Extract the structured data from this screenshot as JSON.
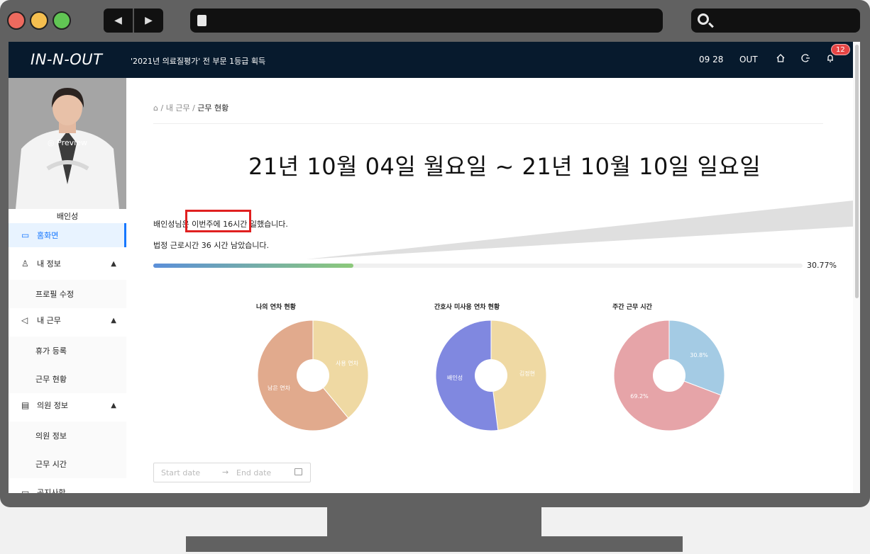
{
  "app": {
    "logo": "IN-N-OUT",
    "notice": "'2021년 의료질평가' 전 부문 1등급 획득"
  },
  "header": {
    "time": "09 28",
    "out_label": "OUT",
    "notification_count": "12"
  },
  "sidebar": {
    "preview_label": "Preview",
    "username": "배인성",
    "items": [
      {
        "label": "홈화면",
        "icon": "monitor-icon"
      },
      {
        "label": "내 정보",
        "icon": "user-icon"
      },
      {
        "label": "프로필 수정"
      },
      {
        "label": "내 근무",
        "icon": "megaphone-icon"
      },
      {
        "label": "휴가 등록"
      },
      {
        "label": "근무 현황"
      },
      {
        "label": "의원 정보",
        "icon": "document-icon"
      },
      {
        "label": "의원 정보"
      },
      {
        "label": "근무 시간"
      },
      {
        "label": "공지사항",
        "icon": "board-icon"
      }
    ]
  },
  "breadcrumb": {
    "home_icon": "home-icon",
    "sep": "/",
    "level1": "내 근무",
    "current": "근무 현황"
  },
  "week": {
    "title": "21년 10월 04일 월요일 ~ 21년 10월 10일 일요일"
  },
  "summary": {
    "line1_prefix": "배인성님은 ",
    "line1_highlight": "이번주에 16시간",
    "line1_suffix": " 일했습니다.",
    "line2": "법정 근로시간 36 시간 남았습니다.",
    "progress_percent": 30.77,
    "progress_label": "30.77%"
  },
  "charts": [
    {
      "title": "나의 연차 현황"
    },
    {
      "title": "간호사 미사용 연차 현황"
    },
    {
      "title": "주간 근무 시간"
    }
  ],
  "chart_data": [
    {
      "type": "pie",
      "title": "나의 연차 현황",
      "categories": [
        "사용 연차",
        "남은 연차"
      ],
      "values": [
        39,
        61
      ],
      "colors": [
        "#efd9a3",
        "#e1aa8d"
      ]
    },
    {
      "type": "pie",
      "title": "간호사 미사용 연차 현황",
      "categories": [
        "김정현",
        "배인성"
      ],
      "values": [
        48,
        52
      ],
      "colors": [
        "#efd9a3",
        "#8088e0"
      ]
    },
    {
      "type": "pie",
      "title": "주간 근무 시간",
      "categories": [
        "30.8%",
        "69.2%"
      ],
      "values": [
        30.8,
        69.2
      ],
      "colors": [
        "#a4cbe4",
        "#e6a4a8"
      ]
    }
  ],
  "daterange": {
    "start_placeholder": "Start date",
    "arrow": "→",
    "end_placeholder": "End date"
  },
  "colors": {
    "topbar": "#071a2d",
    "accent": "#1677ff",
    "highlight": "#e02020"
  }
}
